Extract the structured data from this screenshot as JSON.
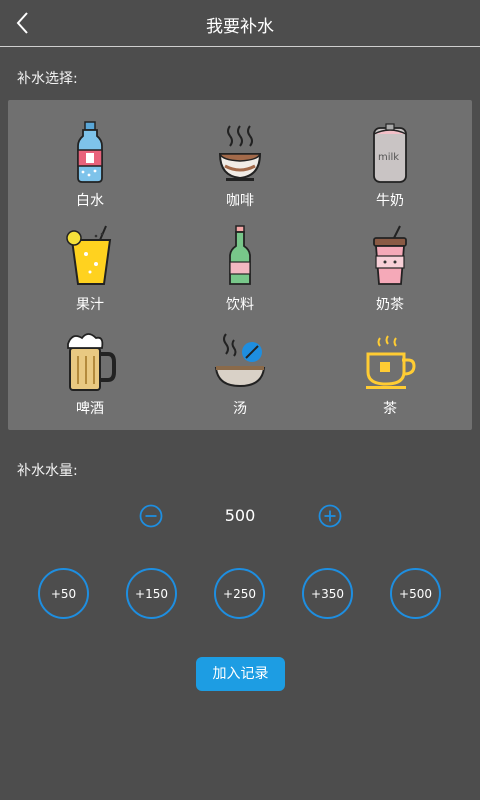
{
  "header": {
    "title": "我要补水"
  },
  "drink_section": {
    "label": "补水选择:"
  },
  "drinks": [
    {
      "label": "白水",
      "icon": "water-bottle-icon"
    },
    {
      "label": "咖啡",
      "icon": "coffee-cup-icon"
    },
    {
      "label": "牛奶",
      "icon": "milk-carton-icon"
    },
    {
      "label": "果汁",
      "icon": "juice-glass-icon"
    },
    {
      "label": "饮料",
      "icon": "soda-bottle-icon"
    },
    {
      "label": "奶茶",
      "icon": "milk-tea-cup-icon"
    },
    {
      "label": "啤酒",
      "icon": "beer-mug-icon"
    },
    {
      "label": "汤",
      "icon": "soup-bowl-icon"
    },
    {
      "label": "茶",
      "icon": "tea-cup-icon"
    }
  ],
  "amount_section": {
    "label": "补水水量:",
    "value": "500"
  },
  "presets": [
    "+50",
    "+150",
    "+250",
    "+350",
    "+500"
  ],
  "actions": {
    "add_label": "加入记录"
  },
  "milk_text": "milk",
  "colors": {
    "accent": "#1e8ee0",
    "button": "#1d9de3",
    "panel": "#707070",
    "background": "#4d4d4d"
  }
}
